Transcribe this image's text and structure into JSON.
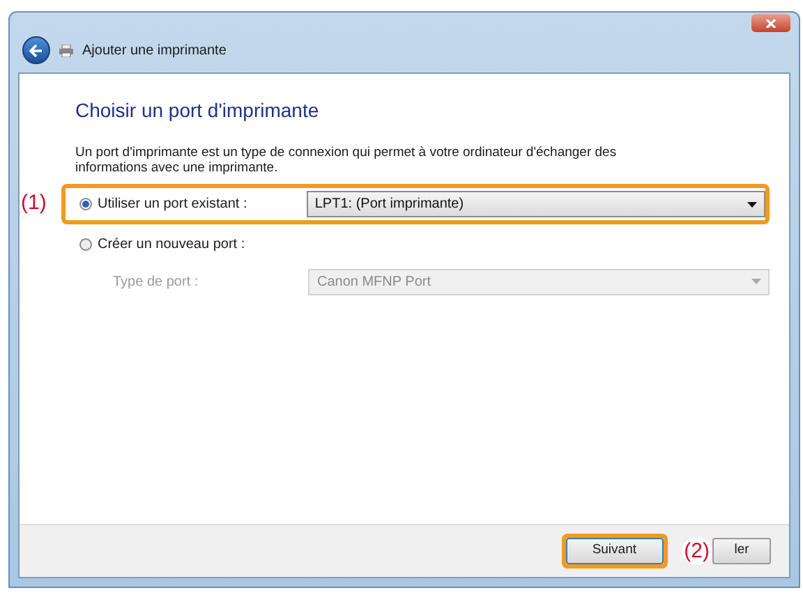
{
  "window": {
    "title": "Ajouter une imprimante"
  },
  "heading": "Choisir un port d'imprimante",
  "description": "Un port d'imprimante est un type de connexion qui permet à votre ordinateur d'échanger des informations avec une imprimante.",
  "options": [
    {
      "label": "Utiliser un port existant :",
      "selected": true,
      "highlighted": true,
      "callout": "(1)",
      "dropdown": {
        "value": "LPT1: (Port imprimante)",
        "disabled": false
      }
    },
    {
      "label": "Créer un nouveau port :",
      "selected": false,
      "highlighted": false,
      "sub_label": "Type de port :",
      "dropdown": {
        "value": "Canon MFNP Port",
        "disabled": true
      }
    }
  ],
  "buttons": [
    {
      "label": "Suivant",
      "highlighted": true
    },
    {
      "label": "ler",
      "highlighted": false,
      "callout": "(2)"
    }
  ]
}
